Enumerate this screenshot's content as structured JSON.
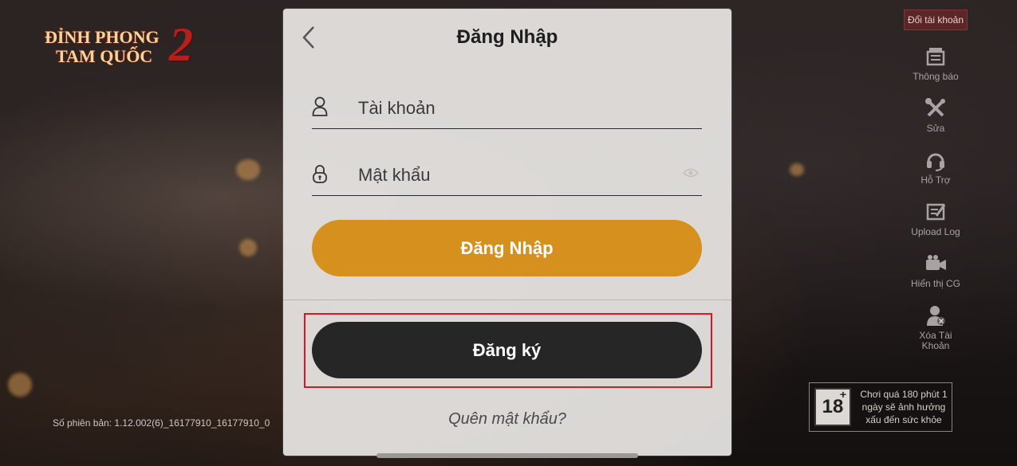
{
  "app": {
    "logo_line1": "ĐỈNH PHONG",
    "logo_line2": "TAM QUỐC",
    "logo_number": "2"
  },
  "version_text": "Số phiên bản: 1.12.002(6)_16177910_16177910_0",
  "right_panel": {
    "switch_account_label": "Đổi tài khoản",
    "items": [
      {
        "label": "Thông báo",
        "icon": "announcement-icon"
      },
      {
        "label": "Sửa",
        "icon": "tools-icon"
      },
      {
        "label": "Hỗ Trợ",
        "icon": "headset-icon"
      },
      {
        "label": "Upload Log",
        "icon": "upload-log-icon"
      },
      {
        "label": "Hiển thị CG",
        "icon": "video-camera-icon"
      },
      {
        "label": "Xóa Tài Khoản",
        "icon": "delete-account-icon"
      }
    ]
  },
  "age_notice": {
    "badge": "18",
    "plus": "+",
    "text": "Chơi quá 180 phút 1 ngày sẽ ảnh hưởng xấu đến sức khỏe"
  },
  "login_dialog": {
    "title": "Đăng Nhập",
    "account_placeholder": "Tài khoản",
    "account_value": "",
    "password_placeholder": "Mật khẩu",
    "password_value": "",
    "login_button": "Đăng Nhập",
    "register_button": "Đăng ký",
    "forgot_password": "Quên mật khẩu?",
    "highlight_color": "#e0161f",
    "login_button_color": "#d6901d",
    "register_button_color": "#262626"
  }
}
